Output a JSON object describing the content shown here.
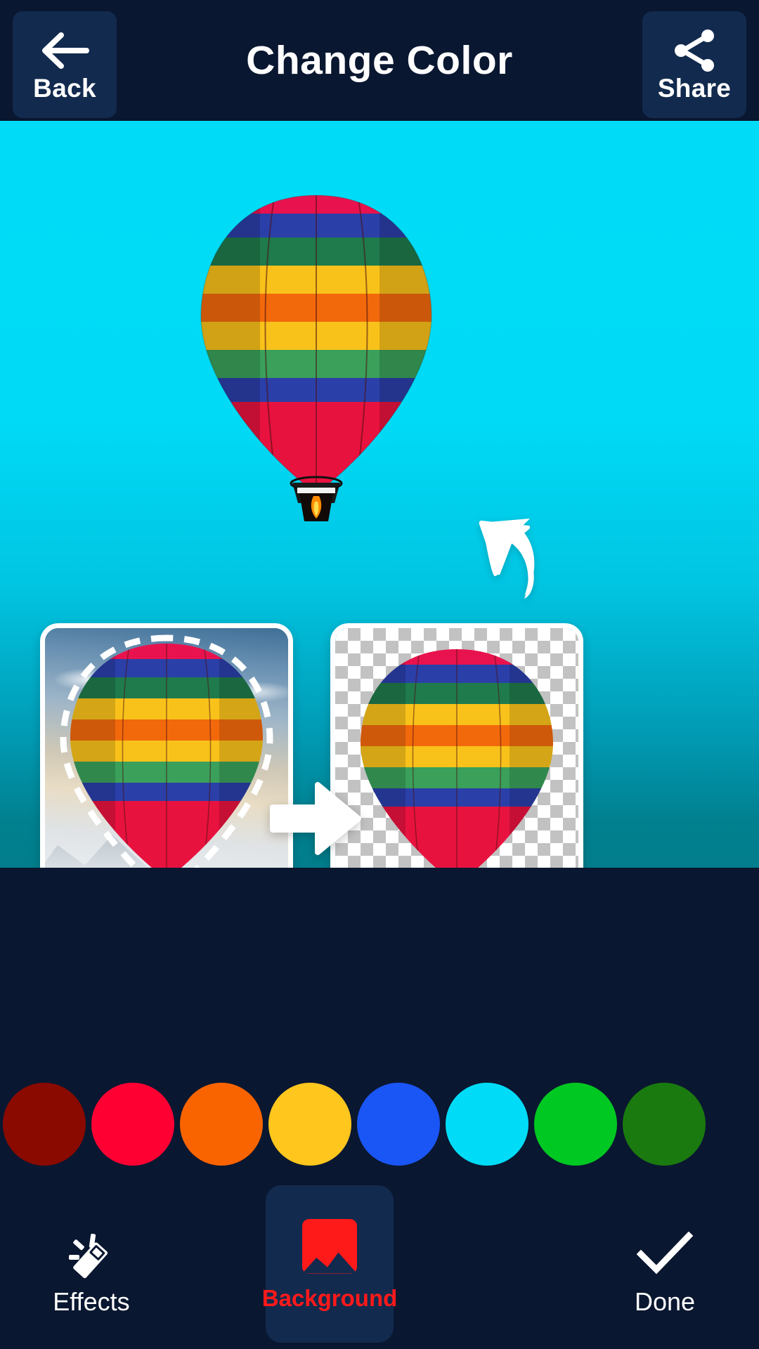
{
  "header": {
    "title": "Change Color",
    "back_label": "Back",
    "back_icon": "arrow-left-icon",
    "share_label": "Share",
    "share_icon": "share-icon"
  },
  "canvas": {
    "background_color": "#00DCF7",
    "subject": "hot-air-balloon",
    "hint_icon": "curved-arrow-up-left-icon"
  },
  "preview": {
    "before_label": "original-with-selection",
    "after_label": "cutout-transparent",
    "transition_icon": "arrow-right-icon"
  },
  "palette": {
    "colors": [
      {
        "name": "dark-red",
        "hex": "#8A0A00"
      },
      {
        "name": "red",
        "hex": "#FF0033"
      },
      {
        "name": "orange",
        "hex": "#FA6400"
      },
      {
        "name": "yellow",
        "hex": "#FFC61E"
      },
      {
        "name": "blue",
        "hex": "#1A56F5"
      },
      {
        "name": "cyan",
        "hex": "#00DCF7"
      },
      {
        "name": "green",
        "hex": "#00C822"
      },
      {
        "name": "dark-green",
        "hex": "#1A7A0F"
      }
    ]
  },
  "bottom_nav": {
    "items": [
      {
        "label": "Effects",
        "icon": "magic-wand-icon",
        "selected": false
      },
      {
        "label": "Background",
        "icon": "image-icon",
        "selected": true
      },
      {
        "label": "Done",
        "icon": "checkmark-icon",
        "selected": false
      }
    ],
    "active_color": "#ff1a1a",
    "inactive_color": "#ffffff"
  }
}
